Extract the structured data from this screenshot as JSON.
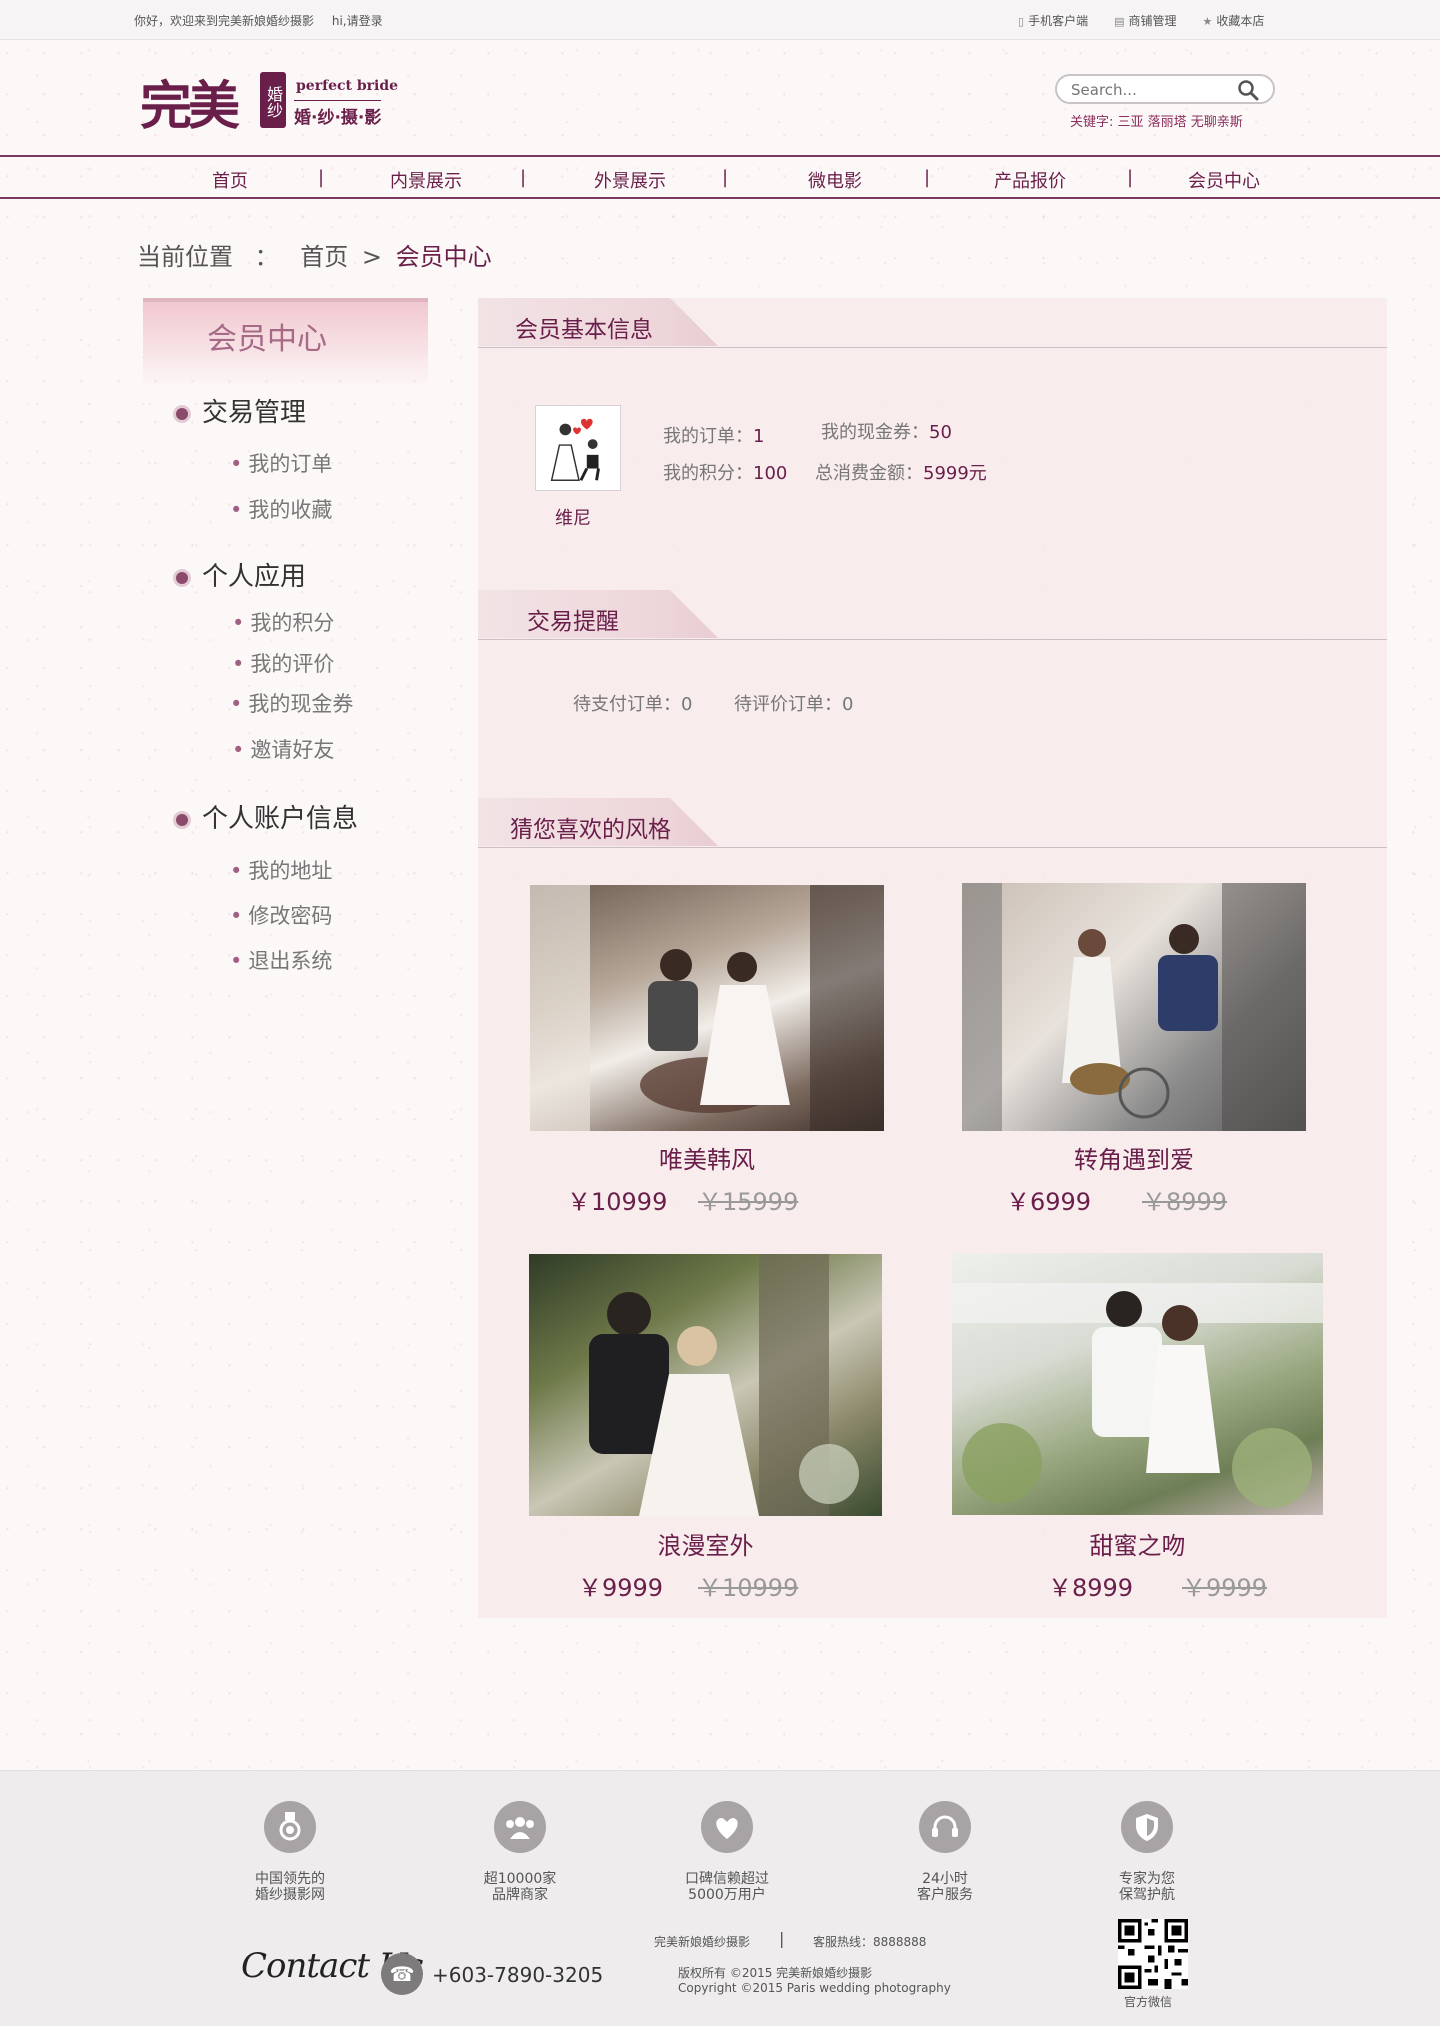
{
  "topbar": {
    "welcome": "你好，欢迎来到完美新娘婚纱摄影",
    "login": "hi,请登录",
    "links": [
      "手机客户端",
      "商铺管理",
      "收藏本店"
    ]
  },
  "logo": {
    "main": "完美",
    "box": "婚纱",
    "en": "perfect bride",
    "cn": "婚·纱·摄·影"
  },
  "search": {
    "placeholder": "Search...",
    "keywords": "关键字: 三亚 落丽塔 无聊亲斯"
  },
  "nav": [
    "首页",
    "内景展示",
    "外景展示",
    "微电影",
    "产品报价",
    "会员中心"
  ],
  "breadcrumb": {
    "label": "当前位置",
    "colon": "：",
    "home": "首页",
    "arrow": ">",
    "current": "会员中心"
  },
  "sidebar": {
    "title": "会员中心",
    "groups": [
      {
        "label": "交易管理",
        "items": [
          "我的订单",
          "我的收藏"
        ]
      },
      {
        "label": "个人应用",
        "items": [
          "我的积分",
          "我的评价",
          "我的现金券",
          "邀请好友"
        ]
      },
      {
        "label": "个人账户信息",
        "items": [
          "我的地址",
          "修改密码",
          "退出系统"
        ]
      }
    ]
  },
  "member": {
    "section_title": "会员基本信息",
    "name": "维尼",
    "orders_label": "我的订单：",
    "orders": "1",
    "coupon_label": "我的现金券：",
    "coupon": "50",
    "points_label": "我的积分：",
    "points": "100",
    "spent_label": "总消费金额：",
    "spent": "5999元"
  },
  "reminder": {
    "section_title": "交易提醒",
    "pending_pay": "待支付订单：0",
    "pending_review": "待评价订单：0"
  },
  "recommend": {
    "section_title": "猜您喜欢的风格",
    "items": [
      {
        "title": "唯美韩风",
        "price": "￥10999",
        "old": "￥15999"
      },
      {
        "title": "转角遇到爱",
        "price": "￥6999",
        "old": "￥8999"
      },
      {
        "title": "浪漫室外",
        "price": "￥9999",
        "old": "￥10999"
      },
      {
        "title": "甜蜜之吻",
        "price": "￥8999",
        "old": "￥9999"
      }
    ]
  },
  "footer": {
    "features": [
      {
        "line1": "中国领先的",
        "line2": "婚纱摄影网"
      },
      {
        "line1": "超10000家",
        "line2": "品牌商家"
      },
      {
        "line1": "口碑信赖超过",
        "line2": "5000万用户"
      },
      {
        "line1": "24小时",
        "line2": "客户服务"
      },
      {
        "line1": "专家为您",
        "line2": "保驾护航"
      }
    ],
    "contact_title": "Contact Us",
    "phone": "+603-7890-3205",
    "company": "完美新娘婚纱摄影",
    "hotline": "客服热线：8888888",
    "copyright_cn": "版权所有 ©2015 完美新娘婚纱摄影",
    "copyright_en": "Copyright ©2015 Paris wedding photography",
    "qr_caption": "官方微信"
  },
  "colors": {
    "brand": "#6a1f4a",
    "accent": "#a15f84",
    "panel": "#f7eaeb"
  }
}
